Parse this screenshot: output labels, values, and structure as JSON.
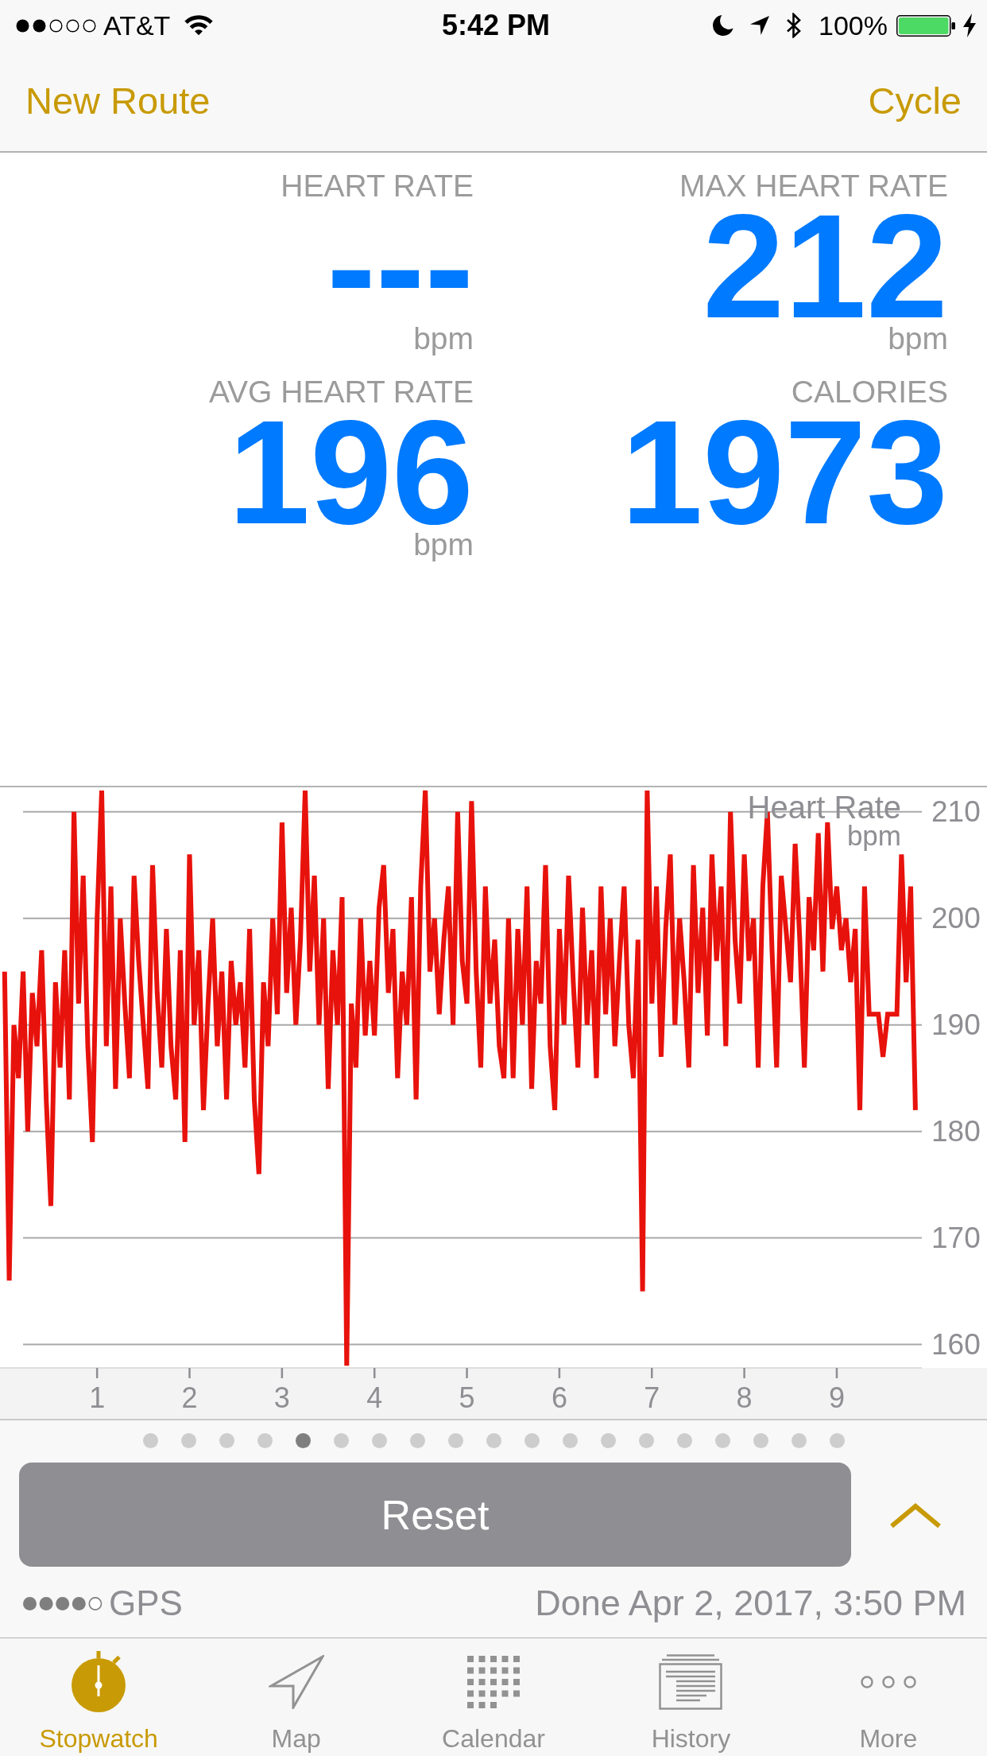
{
  "status_bar": {
    "carrier": "AT&T",
    "time": "5:42 PM",
    "battery": "100%"
  },
  "nav_bar": {
    "left_button": "New Route",
    "right_button": "Cycle"
  },
  "metrics": [
    {
      "label": "HEART RATE",
      "value": "---",
      "unit": "bpm"
    },
    {
      "label": "MAX HEART RATE",
      "value": "212",
      "unit": "bpm"
    },
    {
      "label": "AVG HEART RATE",
      "value": "196",
      "unit": "bpm"
    },
    {
      "label": "CALORIES",
      "value": "1973"
    }
  ],
  "chart": {
    "chart_data": {
      "type": "line",
      "title": "Heart Rate",
      "ylabel": "bpm",
      "grid": true,
      "xlim": [
        -0.05,
        9.92
      ],
      "ylim": [
        157.8,
        212.3
      ],
      "xticks": [
        1,
        2,
        3,
        4,
        5,
        6,
        7,
        8,
        9
      ],
      "yticks": [
        160,
        170,
        180,
        190,
        200,
        210
      ],
      "x": [
        0,
        0.05,
        0.1,
        0.15,
        0.2,
        0.25,
        0.3,
        0.35,
        0.4,
        0.45,
        0.5,
        0.55,
        0.6,
        0.65,
        0.7,
        0.75,
        0.8,
        0.85,
        0.9,
        0.95,
        1,
        1.05,
        1.1,
        1.15,
        1.2,
        1.25,
        1.3,
        1.35,
        1.4,
        1.45,
        1.5,
        1.55,
        1.6,
        1.65,
        1.7,
        1.75,
        1.8,
        1.85,
        1.9,
        1.95,
        2,
        2.05,
        2.1,
        2.15,
        2.2,
        2.25,
        2.3,
        2.35,
        2.4,
        2.45,
        2.5,
        2.55,
        2.6,
        2.65,
        2.7,
        2.75,
        2.8,
        2.85,
        2.9,
        2.95,
        3,
        3.05,
        3.1,
        3.15,
        3.2,
        3.25,
        3.3,
        3.35,
        3.4,
        3.45,
        3.5,
        3.55,
        3.6,
        3.65,
        3.7,
        3.75,
        3.8,
        3.85,
        3.9,
        3.95,
        4,
        4.05,
        4.1,
        4.15,
        4.2,
        4.25,
        4.3,
        4.35,
        4.4,
        4.45,
        4.5,
        4.55,
        4.6,
        4.65,
        4.7,
        4.75,
        4.8,
        4.85,
        4.9,
        4.95,
        5,
        5.05,
        5.1,
        5.15,
        5.2,
        5.25,
        5.3,
        5.35,
        5.4,
        5.45,
        5.5,
        5.55,
        5.6,
        5.65,
        5.7,
        5.75,
        5.8,
        5.85,
        5.9,
        5.95,
        6,
        6.05,
        6.1,
        6.15,
        6.2,
        6.25,
        6.3,
        6.35,
        6.4,
        6.45,
        6.5,
        6.55,
        6.6,
        6.65,
        6.7,
        6.75,
        6.8,
        6.85,
        6.9,
        6.95,
        7,
        7.05,
        7.1,
        7.15,
        7.2,
        7.25,
        7.3,
        7.35,
        7.4,
        7.45,
        7.5,
        7.55,
        7.6,
        7.65,
        7.7,
        7.75,
        7.8,
        7.85,
        7.9,
        7.95,
        8,
        8.05,
        8.1,
        8.15,
        8.2,
        8.25,
        8.3,
        8.35,
        8.4,
        8.45,
        8.5,
        8.55,
        8.6,
        8.65,
        8.7,
        8.75,
        8.8,
        8.85,
        8.9,
        8.95,
        9,
        9.05,
        9.1,
        9.15,
        9.2,
        9.25,
        9.3,
        9.35,
        9.4,
        9.45,
        9.5,
        9.55,
        9.6,
        9.65,
        9.7,
        9.75,
        9.8,
        9.85
      ],
      "series": [
        {
          "color": "#e8120c",
          "values": [
            195,
            166,
            190,
            185,
            195,
            180,
            193,
            188,
            197,
            183,
            173,
            194,
            186,
            197,
            183,
            210,
            192,
            204,
            188,
            179,
            200,
            212,
            188,
            203,
            184,
            200,
            192,
            185,
            204,
            196,
            190,
            184,
            205,
            193,
            186,
            199,
            188,
            183,
            197,
            179,
            206,
            190,
            197,
            182,
            192,
            200,
            188,
            195,
            183,
            196,
            190,
            194,
            186,
            199,
            183,
            176,
            194,
            188,
            200,
            191,
            209,
            193,
            201,
            190,
            198,
            212,
            195,
            204,
            190,
            200,
            184,
            197,
            190,
            202,
            158,
            192,
            186,
            200,
            189,
            196,
            189,
            201,
            205,
            193,
            199,
            185,
            195,
            190,
            202,
            183,
            203,
            212,
            195,
            200,
            191,
            198,
            203,
            190,
            210,
            196,
            192,
            211,
            195,
            186,
            203,
            192,
            198,
            188,
            185,
            200,
            185,
            199,
            190,
            203,
            184,
            196,
            192,
            205,
            188,
            182,
            199,
            190,
            204,
            194,
            186,
            201,
            190,
            197,
            185,
            203,
            191,
            200,
            188,
            196,
            203,
            190,
            185,
            198,
            165,
            212,
            192,
            203,
            187,
            199,
            206,
            190,
            200,
            194,
            186,
            205,
            193,
            201,
            189,
            206,
            196,
            203,
            188,
            210,
            198,
            192,
            206,
            196,
            200,
            186,
            203,
            210,
            197,
            186,
            204,
            199,
            194,
            207,
            198,
            186,
            202,
            197,
            208,
            195,
            209,
            199,
            203,
            197,
            200,
            194,
            199,
            182,
            203,
            191,
            191,
            191,
            187,
            191,
            191,
            191,
            206,
            194,
            203,
            182
          ]
        }
      ]
    }
  },
  "page_indicator": [
    {
      "selected": false
    },
    {
      "selected": false
    },
    {
      "selected": false
    },
    {
      "selected": false
    },
    {
      "selected": true
    },
    {
      "selected": false
    },
    {
      "selected": false
    },
    {
      "selected": false
    },
    {
      "selected": false
    },
    {
      "selected": false
    },
    {
      "selected": false
    },
    {
      "selected": false
    },
    {
      "selected": false
    },
    {
      "selected": false
    },
    {
      "selected": false
    },
    {
      "selected": false
    },
    {
      "selected": false
    },
    {
      "selected": false
    },
    {
      "selected": false
    }
  ],
  "reset_button": {
    "label": "Reset"
  },
  "gps": {
    "label": "GPS"
  },
  "completed": "Done Apr 2, 2017, 3:50 PM",
  "tab_bar": [
    {
      "label": "Stopwatch",
      "selected": true
    },
    {
      "label": "Map",
      "selected": false
    },
    {
      "label": "Calendar",
      "selected": false
    },
    {
      "label": "History",
      "selected": false
    },
    {
      "label": "More",
      "selected": false
    }
  ]
}
